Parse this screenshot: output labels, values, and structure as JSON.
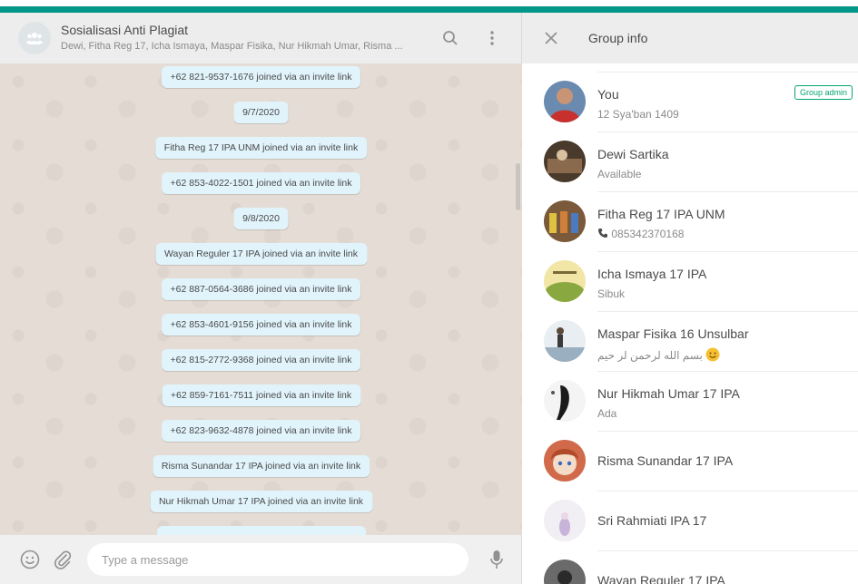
{
  "chat": {
    "title": "Sosialisasi Anti Plagiat",
    "subtitle": "Dewi, Fitha Reg 17, Icha Ismaya, Maspar Fisika, Nur Hikmah Umar, Risma ...",
    "messages": [
      "+62 821-9537-1676 joined via an invite link",
      "9/7/2020",
      "Fitha Reg 17 IPA UNM joined via an invite link",
      "+62 853-4022-1501 joined via an invite link",
      "9/8/2020",
      "Wayan Reguler 17 IPA joined via an invite link",
      "+62 887-0564-3686 joined via an invite link",
      "+62 853-4601-9156 joined via an invite link",
      "+62 815-2772-9368 joined via an invite link",
      "+62 859-7161-7511 joined via an invite link",
      "+62 823-9632-4878 joined via an invite link",
      "Risma Sunandar 17 IPA joined via an invite link",
      "Nur Hikmah Umar 17 IPA joined via an invite link"
    ],
    "compose_placeholder": "Type a message"
  },
  "info": {
    "title": "Group info",
    "admin_badge": "Group admin",
    "participants": [
      {
        "name": "You",
        "status": "12 Sya'ban 1409"
      },
      {
        "name": "Dewi Sartika",
        "status": "Available"
      },
      {
        "name": "Fitha Reg 17 IPA UNM",
        "status": "085342370168"
      },
      {
        "name": "Icha Ismaya 17 IPA",
        "status": "Sibuk"
      },
      {
        "name": "Maspar Fisika 16 Unsulbar",
        "status": "بسم الله لرحمن لر حيم"
      },
      {
        "name": "Nur Hikmah Umar 17 IPA",
        "status": "Ada"
      },
      {
        "name": "Risma Sunandar 17 IPA",
        "status": ""
      },
      {
        "name": "Sri Rahmiati IPA 17",
        "status": ""
      },
      {
        "name": "Wayan Reguler 17 IPA",
        "status": ""
      }
    ]
  },
  "icons": [
    "group-avatar-icon",
    "search-icon",
    "menu-icon",
    "emoji-icon",
    "attach-icon",
    "mic-icon",
    "chevron-down-icon",
    "close-icon",
    "phone-icon",
    "smile-emoji-icon"
  ],
  "colors": {
    "accent": "#009688",
    "chat_bg": "#e5ddd5",
    "system_bubble": "#e1f3fb",
    "admin_green": "#06a572"
  }
}
